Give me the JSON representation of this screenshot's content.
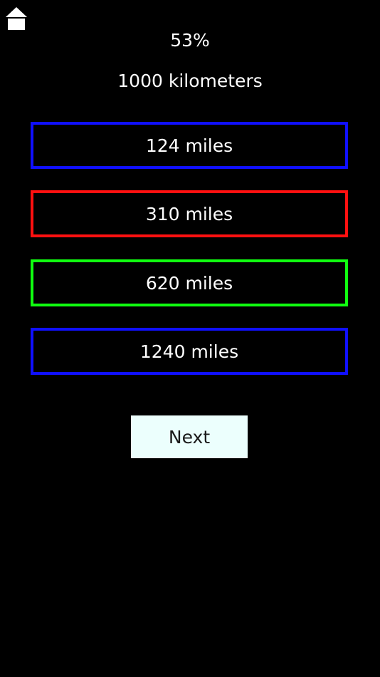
{
  "header": {
    "home_icon": "home-icon"
  },
  "quiz": {
    "progress": "53%",
    "question": "1000 kilometers",
    "answers": [
      {
        "label": "124 miles",
        "state": "neutral",
        "border_color": "#1010ff"
      },
      {
        "label": "310 miles",
        "state": "incorrect",
        "border_color": "#ff1010"
      },
      {
        "label": "620 miles",
        "state": "correct",
        "border_color": "#10ff10"
      },
      {
        "label": "1240 miles",
        "state": "neutral",
        "border_color": "#1010ff"
      }
    ],
    "next_label": "Next"
  }
}
